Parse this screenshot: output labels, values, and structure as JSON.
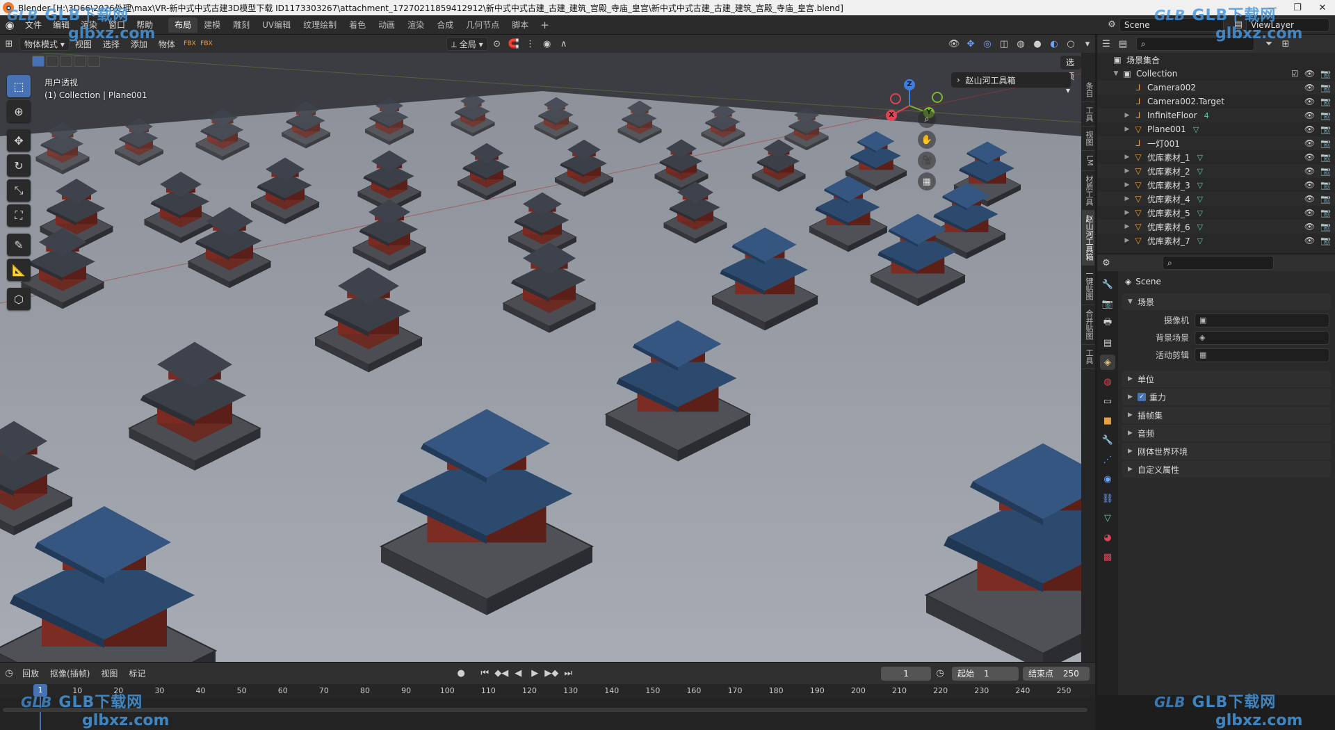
{
  "window": {
    "title": "Blender [H:\\3D66\\2026处理\\max\\VR-新中式中式古建3D模型下载 ID1173303267\\attachment_17270211859412912\\新中式中式古建_古建_建筑_宫殿_寺庙_皇宫\\新中式中式古建_古建_建筑_宫殿_寺庙_皇宫.blend]",
    "minimize": "—",
    "maximize": "❐",
    "close": "✕"
  },
  "menu": {
    "items": [
      "文件",
      "编辑",
      "渲染",
      "窗口",
      "帮助"
    ],
    "workspaces": [
      "布局",
      "建模",
      "雕刻",
      "UV编辑",
      "纹理绘制",
      "着色",
      "动画",
      "渲染",
      "合成",
      "几何节点",
      "脚本"
    ],
    "active_workspace": "布局",
    "add_workspace": "+",
    "scene": "Scene",
    "view_layer": "ViewLayer"
  },
  "viewport_header": {
    "mode": "物体模式",
    "menus": [
      "视图",
      "选择",
      "添加",
      "物体"
    ],
    "transform_orientation": "全局",
    "options": "选项"
  },
  "viewport": {
    "view_name": "用户透视",
    "collection_info": "(1) Collection | Plane001",
    "npanel_tab": "赵山河工具箱",
    "side_tabs": [
      "条目",
      "工具",
      "视图",
      "LM",
      "材质工具",
      "赵山河工具箱",
      "一键贴图",
      "合并贴图",
      "工具"
    ],
    "active_side_tab": "赵山河工具箱",
    "gizmo": {
      "x": "X",
      "y": "Y",
      "z": "Z"
    }
  },
  "outliner": {
    "root": "场景集合",
    "rows": [
      {
        "name": "Collection",
        "type": "collection",
        "indent": 1,
        "extra": ""
      },
      {
        "name": "Camera002",
        "type": "camera",
        "indent": 2,
        "extra": ""
      },
      {
        "name": "Camera002.Target",
        "type": "empty",
        "indent": 2,
        "extra": ""
      },
      {
        "name": "InfiniteFloor",
        "type": "empty",
        "indent": 2,
        "extra": "4"
      },
      {
        "name": "Plane001",
        "type": "mesh",
        "indent": 2,
        "extra": "▽"
      },
      {
        "name": "一灯001",
        "type": "empty",
        "indent": 2,
        "extra": ""
      },
      {
        "name": "优库素材_1",
        "type": "mesh",
        "indent": 2,
        "extra": "▽"
      },
      {
        "name": "优库素材_2",
        "type": "mesh",
        "indent": 2,
        "extra": "▽"
      },
      {
        "name": "优库素材_3",
        "type": "mesh",
        "indent": 2,
        "extra": "▽"
      },
      {
        "name": "优库素材_4",
        "type": "mesh",
        "indent": 2,
        "extra": "▽"
      },
      {
        "name": "优库素材_5",
        "type": "mesh",
        "indent": 2,
        "extra": "▽"
      },
      {
        "name": "优库素材_6",
        "type": "mesh",
        "indent": 2,
        "extra": "▽"
      },
      {
        "name": "优库素材_7",
        "type": "mesh",
        "indent": 2,
        "extra": "▽"
      }
    ]
  },
  "properties": {
    "context": "Scene",
    "scene_panel": "场景",
    "fields": [
      {
        "label": "摄像机",
        "value": ""
      },
      {
        "label": "背景场景",
        "value": ""
      },
      {
        "label": "活动剪辑",
        "value": ""
      }
    ],
    "panels": [
      {
        "label": "单位",
        "checkbox": false
      },
      {
        "label": "重力",
        "checkbox": true
      },
      {
        "label": "插帧集",
        "checkbox": false
      },
      {
        "label": "音频",
        "checkbox": false
      },
      {
        "label": "刚体世界环境",
        "checkbox": false
      },
      {
        "label": "自定义属性",
        "checkbox": false
      }
    ]
  },
  "timeline": {
    "menus": [
      "回放",
      "抠像(插帧)",
      "视图",
      "标记"
    ],
    "current_frame": "1",
    "start_label": "起始",
    "start": "1",
    "end_label": "结束点",
    "end": "250",
    "ticks": [
      "1",
      "10",
      "20",
      "30",
      "40",
      "50",
      "60",
      "70",
      "80",
      "90",
      "100",
      "110",
      "120",
      "130",
      "140",
      "150",
      "160",
      "170",
      "180",
      "190",
      "200",
      "210",
      "220",
      "230",
      "240",
      "250"
    ]
  },
  "watermark": {
    "brand": "GLB下载网",
    "site": "glbxz.com",
    "logo": "GLB"
  },
  "colors": {
    "accent": "#4772b3",
    "viewport_bg": "#3b3d42",
    "floor": "#9ea2ab",
    "roof_blue": "#2c4a6e",
    "wall_red": "#7a2a20",
    "stone": "#4a4c52"
  }
}
